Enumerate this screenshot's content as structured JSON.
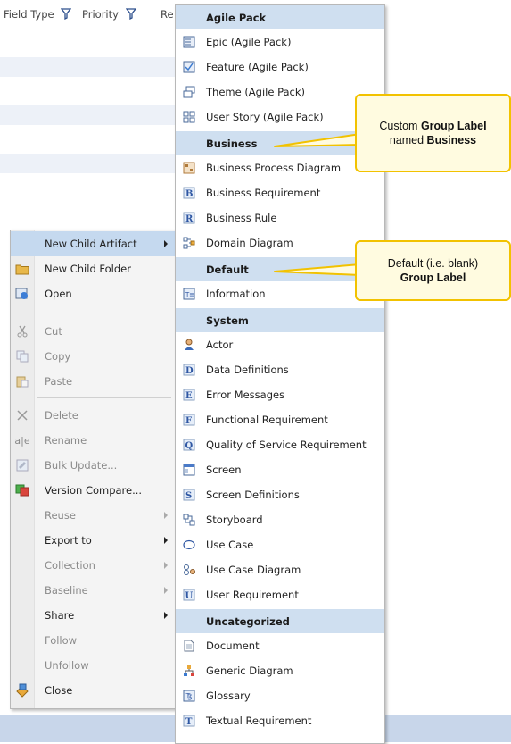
{
  "grid": {
    "columns": [
      {
        "label": "Field Type",
        "has_filter": true
      },
      {
        "label": "Priority",
        "has_filter": true
      },
      {
        "label": "Re",
        "has_filter": false
      }
    ]
  },
  "context_menu": {
    "items": [
      {
        "label": "New Child Artifact",
        "icon": "none",
        "enabled": true,
        "submenu": true,
        "highlighted": true
      },
      {
        "label": "New Child Folder",
        "icon": "folder-icon",
        "enabled": true,
        "submenu": false
      },
      {
        "label": "Open",
        "icon": "open-icon",
        "enabled": true,
        "submenu": false
      },
      {
        "label": "Cut",
        "icon": "scissors-icon",
        "enabled": false,
        "submenu": false
      },
      {
        "label": "Copy",
        "icon": "copy-icon",
        "enabled": false,
        "submenu": false
      },
      {
        "label": "Paste",
        "icon": "paste-icon",
        "enabled": false,
        "submenu": false
      },
      {
        "label": "Delete",
        "icon": "delete-icon",
        "enabled": false,
        "submenu": false
      },
      {
        "label": "Rename",
        "icon": "rename-icon",
        "enabled": false,
        "submenu": false
      },
      {
        "label": "Bulk Update...",
        "icon": "bulk-update-icon",
        "enabled": false,
        "submenu": false
      },
      {
        "label": "Version Compare...",
        "icon": "version-compare-icon",
        "enabled": true,
        "submenu": false
      },
      {
        "label": "Reuse",
        "icon": "none",
        "enabled": false,
        "submenu": true
      },
      {
        "label": "Export to",
        "icon": "none",
        "enabled": true,
        "submenu": true
      },
      {
        "label": "Collection",
        "icon": "none",
        "enabled": false,
        "submenu": true
      },
      {
        "label": "Baseline",
        "icon": "none",
        "enabled": false,
        "submenu": true
      },
      {
        "label": "Share",
        "icon": "none",
        "enabled": true,
        "submenu": true
      },
      {
        "label": "Follow",
        "icon": "none",
        "enabled": false,
        "submenu": false
      },
      {
        "label": "Unfollow",
        "icon": "none",
        "enabled": false,
        "submenu": false
      },
      {
        "label": "Close",
        "icon": "close-icon",
        "enabled": true,
        "submenu": false
      }
    ]
  },
  "submenu": {
    "groups": [
      {
        "label": "Agile Pack",
        "items": [
          {
            "label": "Epic (Agile Pack)",
            "icon": "epic-icon"
          },
          {
            "label": "Feature (Agile Pack)",
            "icon": "feature-icon"
          },
          {
            "label": "Theme (Agile Pack)",
            "icon": "theme-icon"
          },
          {
            "label": "User Story (Agile Pack)",
            "icon": "user-story-icon"
          }
        ]
      },
      {
        "label": "Business",
        "items": [
          {
            "label": "Business Process Diagram",
            "icon": "process-diagram-icon"
          },
          {
            "label": "Business Requirement",
            "icon": "business-requirement-icon"
          },
          {
            "label": "Business Rule",
            "icon": "business-rule-icon"
          },
          {
            "label": "Domain Diagram",
            "icon": "domain-diagram-icon"
          }
        ]
      },
      {
        "label": "Default",
        "items": [
          {
            "label": "Information",
            "icon": "information-icon"
          }
        ]
      },
      {
        "label": "System",
        "items": [
          {
            "label": "Actor",
            "icon": "actor-icon"
          },
          {
            "label": "Data Definitions",
            "icon": "data-definitions-icon"
          },
          {
            "label": "Error Messages",
            "icon": "error-messages-icon"
          },
          {
            "label": "Functional Requirement",
            "icon": "functional-requirement-icon"
          },
          {
            "label": "Quality of Service Requirement",
            "icon": "qos-requirement-icon"
          },
          {
            "label": "Screen",
            "icon": "screen-icon"
          },
          {
            "label": "Screen Definitions",
            "icon": "screen-definitions-icon"
          },
          {
            "label": "Storyboard",
            "icon": "storyboard-icon"
          },
          {
            "label": "Use Case",
            "icon": "use-case-icon"
          },
          {
            "label": "Use Case Diagram",
            "icon": "use-case-diagram-icon"
          },
          {
            "label": "User Requirement",
            "icon": "user-requirement-icon"
          }
        ]
      },
      {
        "label": "Uncategorized",
        "items": [
          {
            "label": "Document",
            "icon": "document-icon"
          },
          {
            "label": "Generic Diagram",
            "icon": "generic-diagram-icon"
          },
          {
            "label": "Glossary",
            "icon": "glossary-icon"
          },
          {
            "label": "Textual Requirement",
            "icon": "textual-requirement-icon"
          }
        ]
      }
    ]
  },
  "callouts": {
    "business": {
      "line1": "Custom ",
      "bold1": "Group Label",
      "line2": "named ",
      "bold2": "Business"
    },
    "default": {
      "line1": "Default (i.e. blank)",
      "bold1": "Group Label"
    }
  },
  "colors": {
    "group_header": "#cfdff0",
    "highlight": "#c5d9ef",
    "callout_border": "#f2c200",
    "callout_fill": "#fffbe0"
  }
}
